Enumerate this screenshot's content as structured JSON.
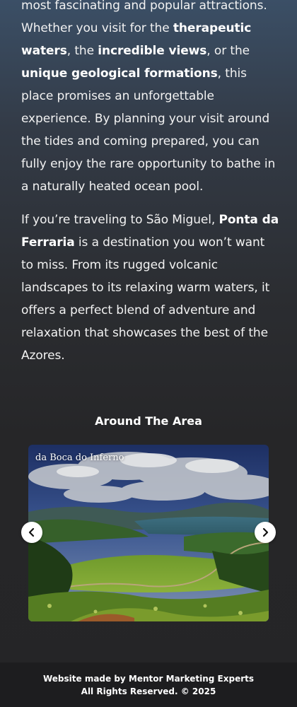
{
  "article": {
    "p1": [
      {
        "text": "most fascinating and popular attractions.",
        "bold": false
      },
      {
        "text": " Whether you visit for the ",
        "bold": false
      },
      {
        "text": "therapeutic waters",
        "bold": true
      },
      {
        "text": ", the ",
        "bold": false
      },
      {
        "text": "incredible views",
        "bold": true
      },
      {
        "text": ", or the ",
        "bold": false
      },
      {
        "text": "unique geological formations",
        "bold": true
      },
      {
        "text": ", this place promises an unforgettable experience. By planning your visit around the tides and coming prepared, you can fully enjoy the rare opportunity to bathe in a naturally heated ocean pool.",
        "bold": false
      }
    ],
    "p2": [
      {
        "text": "If you’re traveling to São Miguel, ",
        "bold": false
      },
      {
        "text": "Ponta da Ferraria",
        "bold": true
      },
      {
        "text": " is a destination you won’t want to miss. From its rugged volcanic landscapes to its relaxing warm waters, it offers a perfect blend of adventure and relaxation that showcases the best of the Azores.",
        "bold": false
      }
    ]
  },
  "around": {
    "title": "Around The Area",
    "slide_caption": "da Boca do Inferno",
    "prev_icon": "chevron-left-icon",
    "next_icon": "chevron-right-icon"
  },
  "footer": {
    "line1": "Website made by Mentor Marketing Experts",
    "line2": "All Rights Reserved. © 2025"
  }
}
